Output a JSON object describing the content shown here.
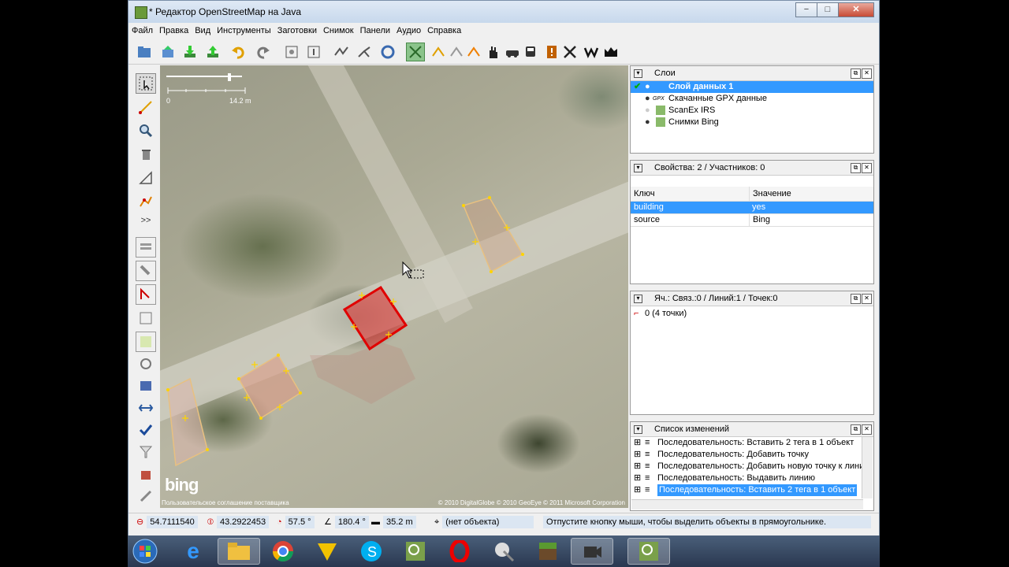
{
  "window": {
    "title": "* Редактор OpenStreetMap на Java",
    "min": "−",
    "max": "□",
    "close": "✕"
  },
  "menu": [
    "Файл",
    "Правка",
    "Вид",
    "Инструменты",
    "Заготовки",
    "Снимок",
    "Панели",
    "Аудио",
    "Справка"
  ],
  "map": {
    "scale_start": "0",
    "scale_end": "14.2 m",
    "bing_logo": "bing",
    "terms": "Пользовательское соглашение поставщика",
    "copyright": "© 2010 DigitalGlobe © 2010 GeoEye © 2011 Microsoft Corporation"
  },
  "layers": {
    "title": "Слои",
    "items": [
      {
        "label": "Слой данных 1",
        "selected": true
      },
      {
        "label": "Скачанные GPX данные",
        "prefix": "GPX"
      },
      {
        "label": "ScanEx IRS"
      },
      {
        "label": "Снимки Bing"
      }
    ]
  },
  "properties": {
    "title": "Свойства: 2 / Участников: 0",
    "col_key": "Ключ",
    "col_value": "Значение",
    "rows": [
      {
        "key": "building",
        "value": "yes"
      },
      {
        "key": "source",
        "value": "Bing"
      }
    ]
  },
  "relations": {
    "title": "Яч.: Связ.:0 / Линий:1 / Точек:0",
    "item": "0 (4 точки)"
  },
  "changes": {
    "title": "Список изменений",
    "items": [
      "Последовательность: Вставить 2 тега в 1 объект",
      "Последовательность: Добавить точку",
      "Последовательность: Добавить новую точку к лини",
      "Последовательность: Выдавить линию",
      "Последовательность: Вставить 2 тега в 1 объект"
    ]
  },
  "status": {
    "lat": "54.7111540",
    "lon": "43.2922453",
    "heading": "57.5 °",
    "angle": "180.4 °",
    "distance": "35.2 m",
    "object": "(нет объекта)",
    "hint": "Отпустите кнопку мыши, чтобы выделить объекты в прямоугольнике."
  },
  "colors": {
    "selection": "#3399ff",
    "selected_way": "#e00000",
    "way": "#e8c080"
  }
}
